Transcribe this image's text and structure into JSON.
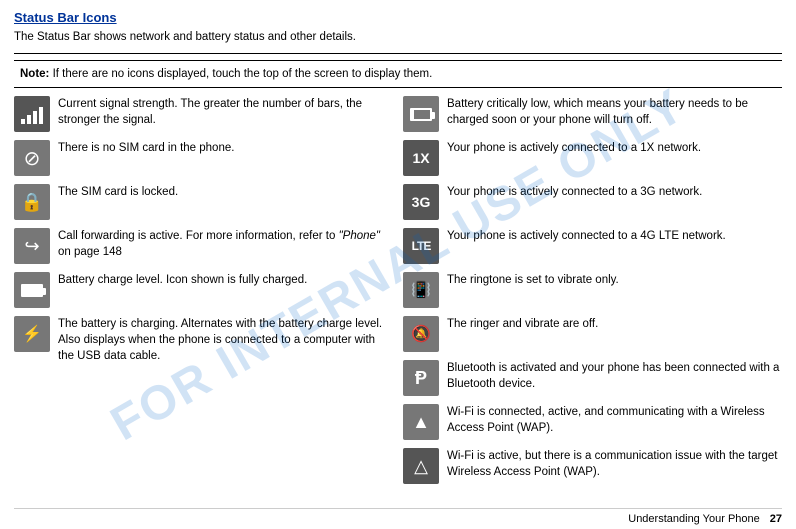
{
  "header": {
    "title": "Status Bar Icons"
  },
  "intro": "The Status Bar shows network and battery status and other details.",
  "note": {
    "label": "Note:",
    "text": " If there are no icons displayed, touch the top of the screen to display them."
  },
  "left_items": [
    {
      "icon": "signal",
      "desc": "Current signal strength. The greater the number of bars, the stronger the signal."
    },
    {
      "icon": "nosim",
      "desc": "There is no SIM card in the phone."
    },
    {
      "icon": "locked",
      "desc": "The SIM card is locked."
    },
    {
      "icon": "forward",
      "desc": "Call forwarding is active. For more information, refer to “Phone” on page 148"
    },
    {
      "icon": "battery",
      "desc": "Battery charge level. Icon shown is fully charged."
    },
    {
      "icon": "charging",
      "desc": "The battery is charging. Alternates with the battery charge level. Also displays when the phone is connected to a computer with the USB data cable."
    }
  ],
  "right_items": [
    {
      "icon": "battery_low",
      "desc": "Battery critically low, which means your battery needs to be charged soon or your phone will turn off."
    },
    {
      "icon": "1x",
      "desc": "Your phone is actively connected to a 1X network."
    },
    {
      "icon": "3g",
      "desc": "Your phone is actively connected to a 3G network."
    },
    {
      "icon": "lte",
      "desc": "Your phone is actively connected to a 4G LTE network."
    },
    {
      "icon": "vibrate",
      "desc": "The ringtone is set to vibrate only."
    },
    {
      "icon": "ringer_off",
      "desc": "The ringer and vibrate are off."
    },
    {
      "icon": "bluetooth",
      "desc": "Bluetooth is activated and your phone has been connected with a Bluetooth device."
    },
    {
      "icon": "wifi_ok",
      "desc": "Wi-Fi is connected, active, and communicating with a Wireless Access Point (WAP)."
    },
    {
      "icon": "wifi_issue",
      "desc": "Wi-Fi is active, but there is a communication issue with the target Wireless Access Point (WAP)."
    }
  ],
  "footer": {
    "label": "Understanding Your Phone",
    "page": "27"
  },
  "watermark": "FOR INTERNAL USE ONLY"
}
